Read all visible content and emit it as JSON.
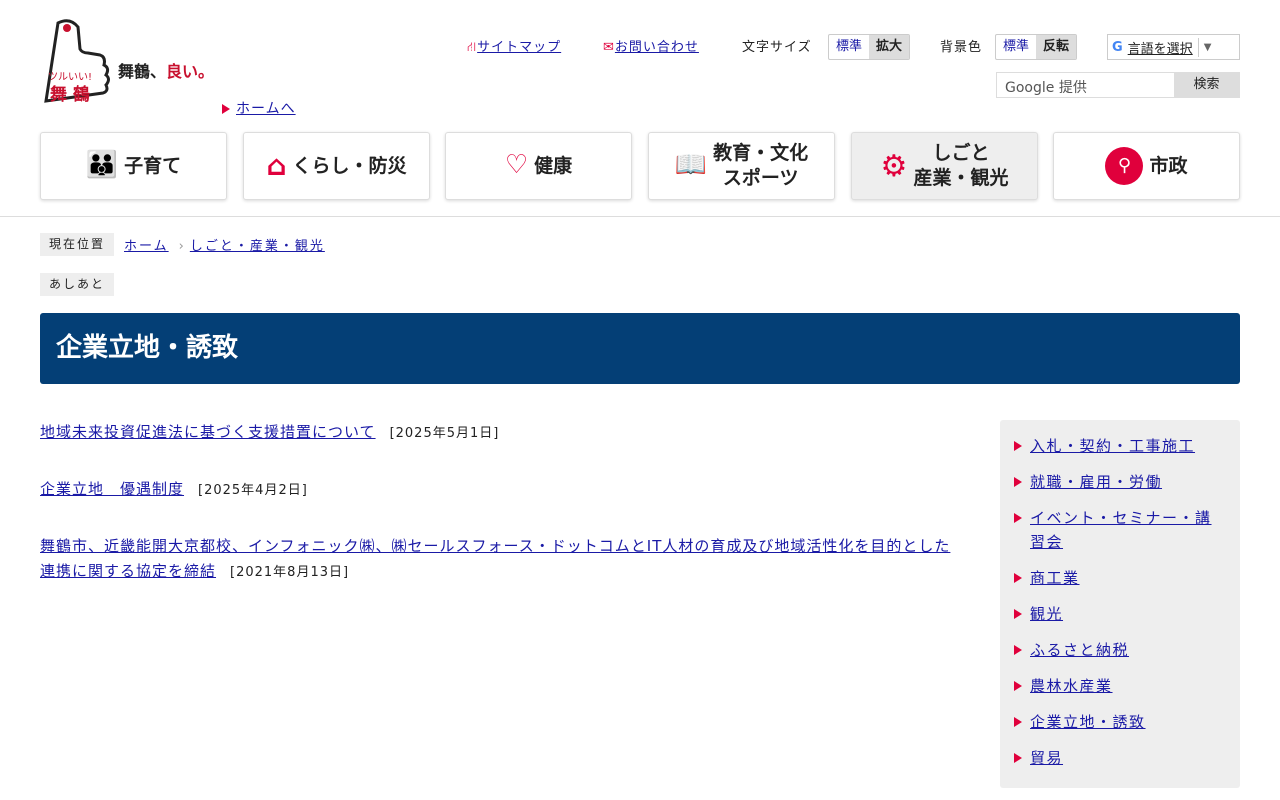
{
  "header": {
    "logo_text": "ツルいい! 舞鶴",
    "tagline_black": "舞鶴、",
    "tagline_red": "良い。",
    "home_link": "ホームへ"
  },
  "util": {
    "sitemap": "サイトマップ",
    "contact": "お問い合わせ",
    "font_size_label": "文字サイズ",
    "font_std": "標準",
    "font_large": "拡大",
    "bg_label": "背景色",
    "bg_std": "標準",
    "bg_invert": "反転",
    "lang": "言語を選択",
    "search_placeholder": "Google 提供",
    "search_btn": "検索"
  },
  "nav": [
    {
      "label": "子育て",
      "icon": "family-icon"
    },
    {
      "label": "くらし・防災",
      "icon": "house-icon"
    },
    {
      "label": "健康",
      "icon": "heart-hand-icon"
    },
    {
      "label": "教育・文化\nスポーツ",
      "icon": "book-icon"
    },
    {
      "label": "しごと\n産業・観光",
      "icon": "gear-icon"
    },
    {
      "label": "市政",
      "icon": "city-emblem-icon"
    }
  ],
  "breadcrumb": {
    "label": "現在位置",
    "items": [
      "ホーム",
      "しごと・産業・観光"
    ]
  },
  "ashiato": "あしあと",
  "page_title": "企業立地・誘致",
  "articles": [
    {
      "title": "地域未来投資促進法に基づく支援措置について",
      "date": "[2025年5月1日]"
    },
    {
      "title": "企業立地　優遇制度",
      "date": "[2025年4月2日]"
    },
    {
      "title": "舞鶴市、近畿能開大京都校、インフォニック㈱、㈱セールスフォース・ドットコムとIT人材の育成及び地域活性化を目的とした連携に関する協定を締結",
      "date": "[2021年8月13日]"
    }
  ],
  "sidebar": [
    "入札・契約・工事施工",
    "就職・雇用・労働",
    "イベント・セミナー・講習会",
    "商工業",
    "観光",
    "ふるさと納税",
    "農林水産業",
    "企業立地・誘致",
    "貿易"
  ],
  "colors": {
    "accent": "#e0003c",
    "title_bg": "#043f76",
    "link": "#1a1aa6"
  }
}
